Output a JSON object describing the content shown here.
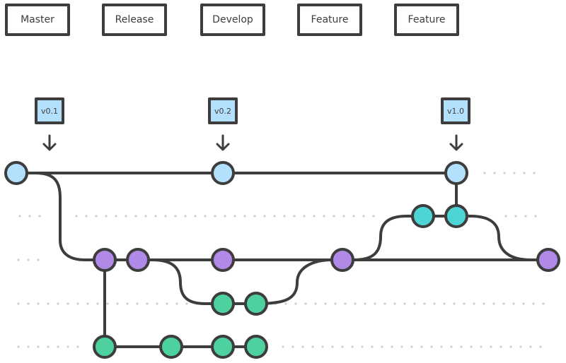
{
  "colors": {
    "master": "#b3e1fd",
    "release": "#4dd4d4",
    "develop": "#b08ae6",
    "feature": "#4dd19e",
    "stroke": "#3d3d3d",
    "dots": "#d0d0d0"
  },
  "legend": [
    {
      "label": "Master",
      "branch": "master"
    },
    {
      "label": "Release",
      "branch": "release"
    },
    {
      "label": "Develop",
      "branch": "develop"
    },
    {
      "label": "Feature",
      "branch": "feature"
    },
    {
      "label": "Feature",
      "branch": "feature"
    }
  ],
  "tags": [
    {
      "label": "v0.1",
      "commit": "m1"
    },
    {
      "label": "v0.2",
      "commit": "m2"
    },
    {
      "label": "v1.0",
      "commit": "m3"
    }
  ],
  "lanes": [
    "master",
    "release",
    "develop",
    "feature-a",
    "feature-b"
  ],
  "commits": [
    {
      "id": "m1",
      "lane": "master",
      "branch": "master",
      "order": 0
    },
    {
      "id": "m2",
      "lane": "master",
      "branch": "master",
      "order": 6
    },
    {
      "id": "m3",
      "lane": "master",
      "branch": "master",
      "order": 12
    },
    {
      "id": "r1",
      "lane": "release",
      "branch": "release",
      "order": 11
    },
    {
      "id": "r2",
      "lane": "release",
      "branch": "release",
      "order": 12
    },
    {
      "id": "d1",
      "lane": "develop",
      "branch": "develop",
      "order": 2
    },
    {
      "id": "d2",
      "lane": "develop",
      "branch": "develop",
      "order": 3
    },
    {
      "id": "d3",
      "lane": "develop",
      "branch": "develop",
      "order": 6
    },
    {
      "id": "d4",
      "lane": "develop",
      "branch": "develop",
      "order": 9
    },
    {
      "id": "d5",
      "lane": "develop",
      "branch": "develop",
      "order": 15
    },
    {
      "id": "fa1",
      "lane": "feature-a",
      "branch": "feature",
      "order": 6
    },
    {
      "id": "fa2",
      "lane": "feature-a",
      "branch": "feature",
      "order": 7
    },
    {
      "id": "fb1",
      "lane": "feature-b",
      "branch": "feature",
      "order": 2
    },
    {
      "id": "fb2",
      "lane": "feature-b",
      "branch": "feature",
      "order": 4
    },
    {
      "id": "fb3",
      "lane": "feature-b",
      "branch": "feature",
      "order": 6
    },
    {
      "id": "fb4",
      "lane": "feature-b",
      "branch": "feature",
      "order": 7
    }
  ]
}
